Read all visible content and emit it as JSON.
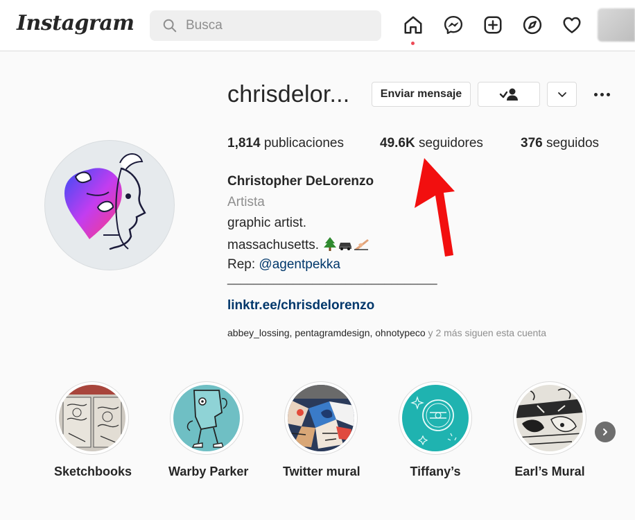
{
  "header": {
    "logo": "Instagram",
    "search_placeholder": "Busca",
    "nav_icons": [
      "home-icon",
      "messenger-icon",
      "new-post-icon",
      "explore-icon",
      "activity-heart-icon",
      "profile-avatar"
    ]
  },
  "profile": {
    "username": "chrisdelor...",
    "message_button": "Enviar mensaje",
    "stats": {
      "posts_count": "1,814",
      "posts_label": "publicaciones",
      "followers_count": "49.6K",
      "followers_label": "seguidores",
      "following_count": "376",
      "following_label": "seguidos"
    },
    "bio": {
      "full_name": "Christopher DeLorenzo",
      "category": "Artista",
      "line1": "graphic artist.",
      "line2": "massachusetts.",
      "line3_prefix": "Rep: ",
      "line3_mention": "@agentpekka",
      "divider": "________________________________",
      "link": "linktr.ee/chrisdelorenzo"
    },
    "followed_by": {
      "account1": "abbey_lossing",
      "sep1": ", ",
      "account2": "pentagramdesign",
      "sep2": ", ",
      "account3": "ohnotypeco",
      "suffix": " y 2 más siguen esta cuenta"
    }
  },
  "highlights": [
    {
      "label": "Sketchbooks"
    },
    {
      "label": "Warby Parker"
    },
    {
      "label": "Twitter mural"
    },
    {
      "label": "Tiffany’s"
    },
    {
      "label": "Earl’s Mural"
    }
  ],
  "colors": {
    "annotation_arrow": "#f20f0f",
    "link": "#00376b",
    "notification_dot": "#ed4956"
  }
}
